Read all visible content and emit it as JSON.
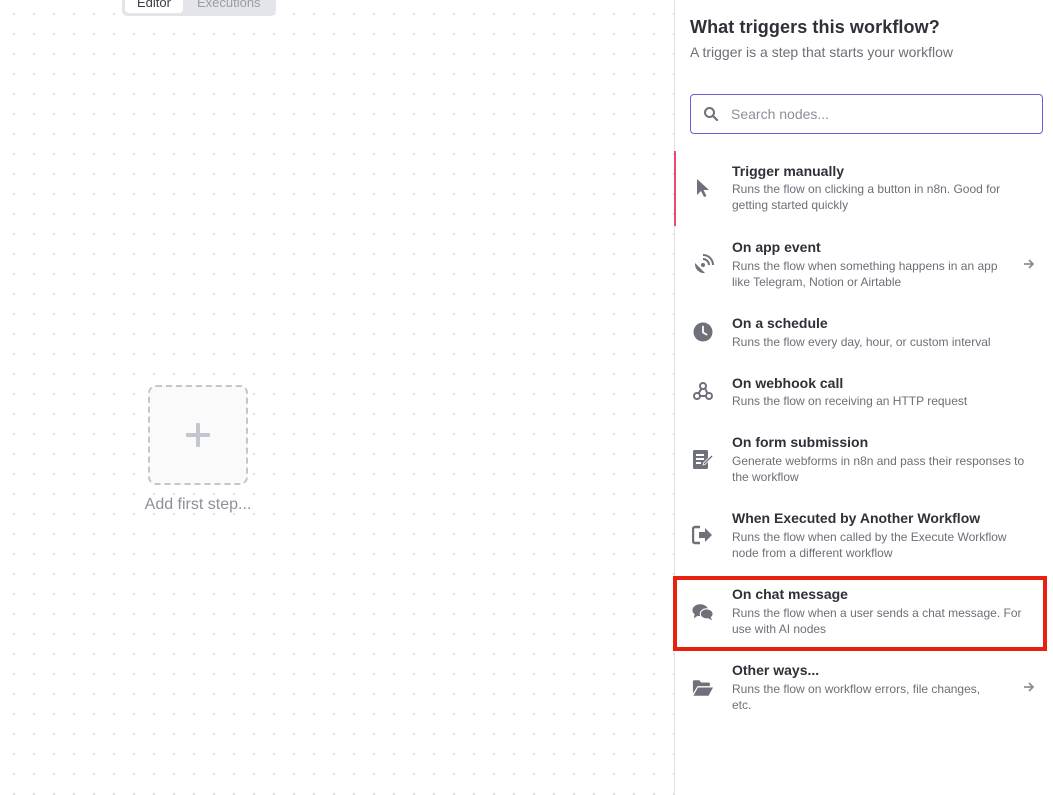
{
  "canvas": {
    "tabs": [
      "Editor",
      "Executions"
    ],
    "add_first_step_label": "Add first step..."
  },
  "panel": {
    "title": "What triggers this workflow?",
    "subtitle": "A trigger is a step that starts your workflow",
    "search_placeholder": "Search nodes...",
    "items": [
      {
        "title": "Trigger manually",
        "desc": "Runs the flow on clicking a button in n8n. Good for getting started quickly",
        "icon": "cursor-icon"
      },
      {
        "title": "On app event",
        "desc": "Runs the flow when something happens in an app like Telegram, Notion or Airtable",
        "icon": "satellite-dish-icon"
      },
      {
        "title": "On a schedule",
        "desc": "Runs the flow every day, hour, or custom interval",
        "icon": "clock-icon"
      },
      {
        "title": "On webhook call",
        "desc": "Runs the flow on receiving an HTTP request",
        "icon": "webhook-icon"
      },
      {
        "title": "On form submission",
        "desc": "Generate webforms in n8n and pass their responses to the workflow",
        "icon": "form-icon"
      },
      {
        "title": "When Executed by Another Workflow",
        "desc": "Runs the flow when called by the Execute Workflow node from a different workflow",
        "icon": "sign-in-icon"
      },
      {
        "title": "On chat message",
        "desc": "Runs the flow when a user sends a chat message. For use with AI nodes",
        "icon": "chat-icon"
      },
      {
        "title": "Other ways...",
        "desc": "Runs the flow on workflow errors, file changes, etc.",
        "icon": "folder-open-icon"
      }
    ]
  },
  "colors": {
    "accent": "#ea4b71",
    "search_border": "#6b5fd6",
    "highlight": "#e8210f"
  }
}
